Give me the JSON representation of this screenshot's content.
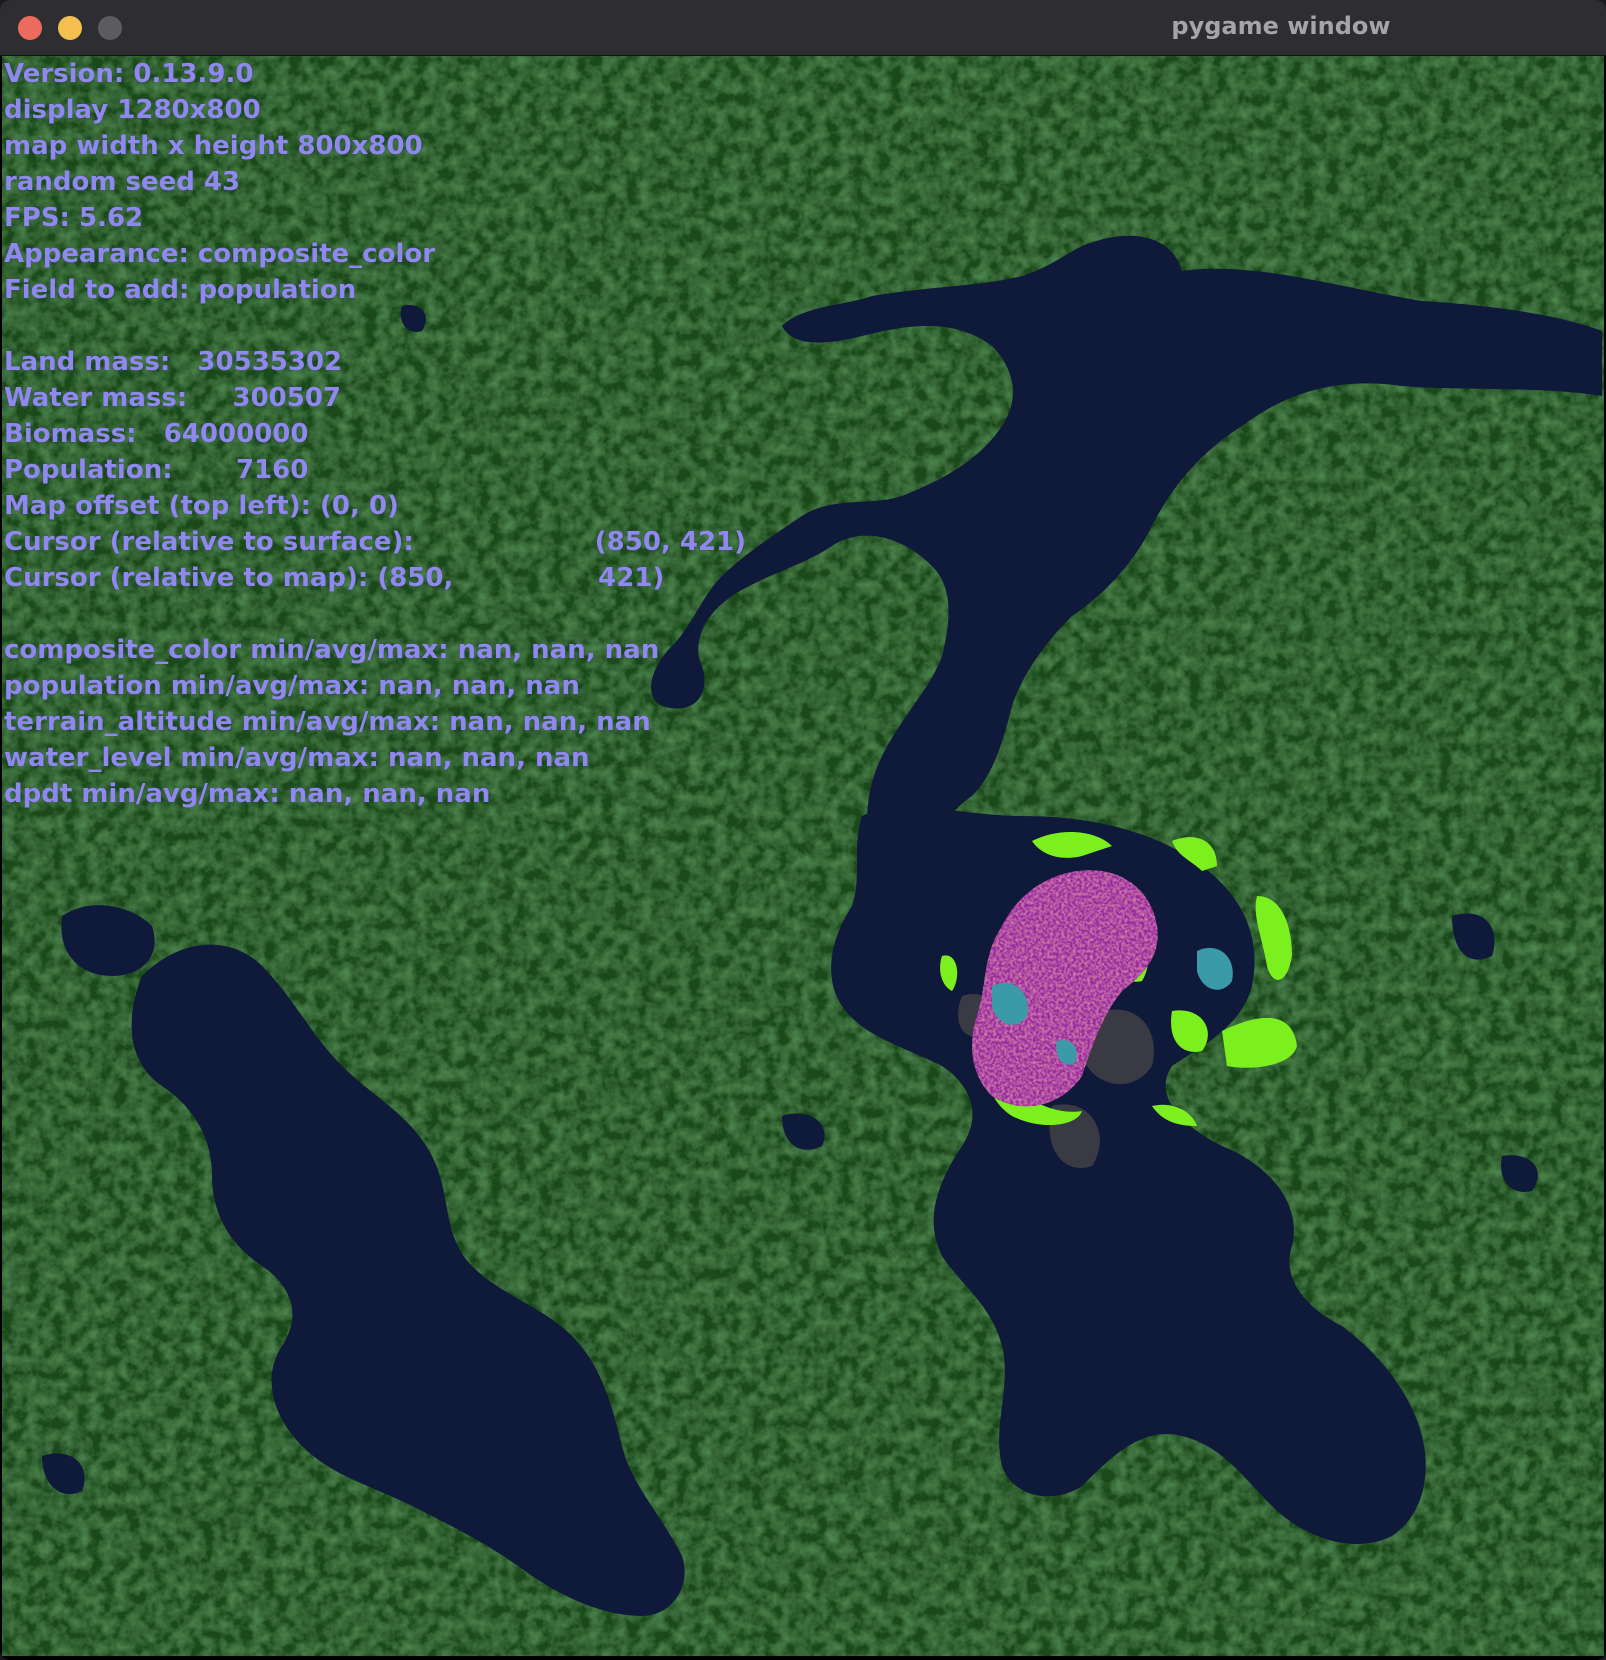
{
  "window": {
    "title": "pygame window"
  },
  "hud": {
    "lines": [
      "Version: 0.13.9.0",
      "display 1280x800",
      "map width x height 800x800",
      "random seed 43",
      "FPS: 5.62",
      "Appearance: composite_color",
      "Field to add: population",
      "",
      "Land mass:   30535302",
      "Water mass:     300507",
      "Biomass:   64000000",
      "Population:       7160",
      "Map offset (top left): (0, 0)",
      "Cursor (relative to surface):                    (850, 421)",
      "Cursor (relative to map): (850,                421)",
      "",
      "composite_color min/avg/max: nan, nan, nan",
      "population min/avg/max: nan, nan, nan",
      "terrain_altitude min/avg/max: nan, nan, nan",
      "water_level min/avg/max: nan, nan, nan",
      "dpdt min/avg/max: nan, nan, nan"
    ]
  },
  "map": {
    "land_color": "#1f4a1f",
    "land_highlight_color": "#2d6a2a",
    "water_color": "#0f1a3a",
    "rock_color": "#3a3a44",
    "vegetation_bright_color": "#7cf01f",
    "population_color": "#9a2aa0",
    "population_alt_color": "#3a9aa8"
  }
}
